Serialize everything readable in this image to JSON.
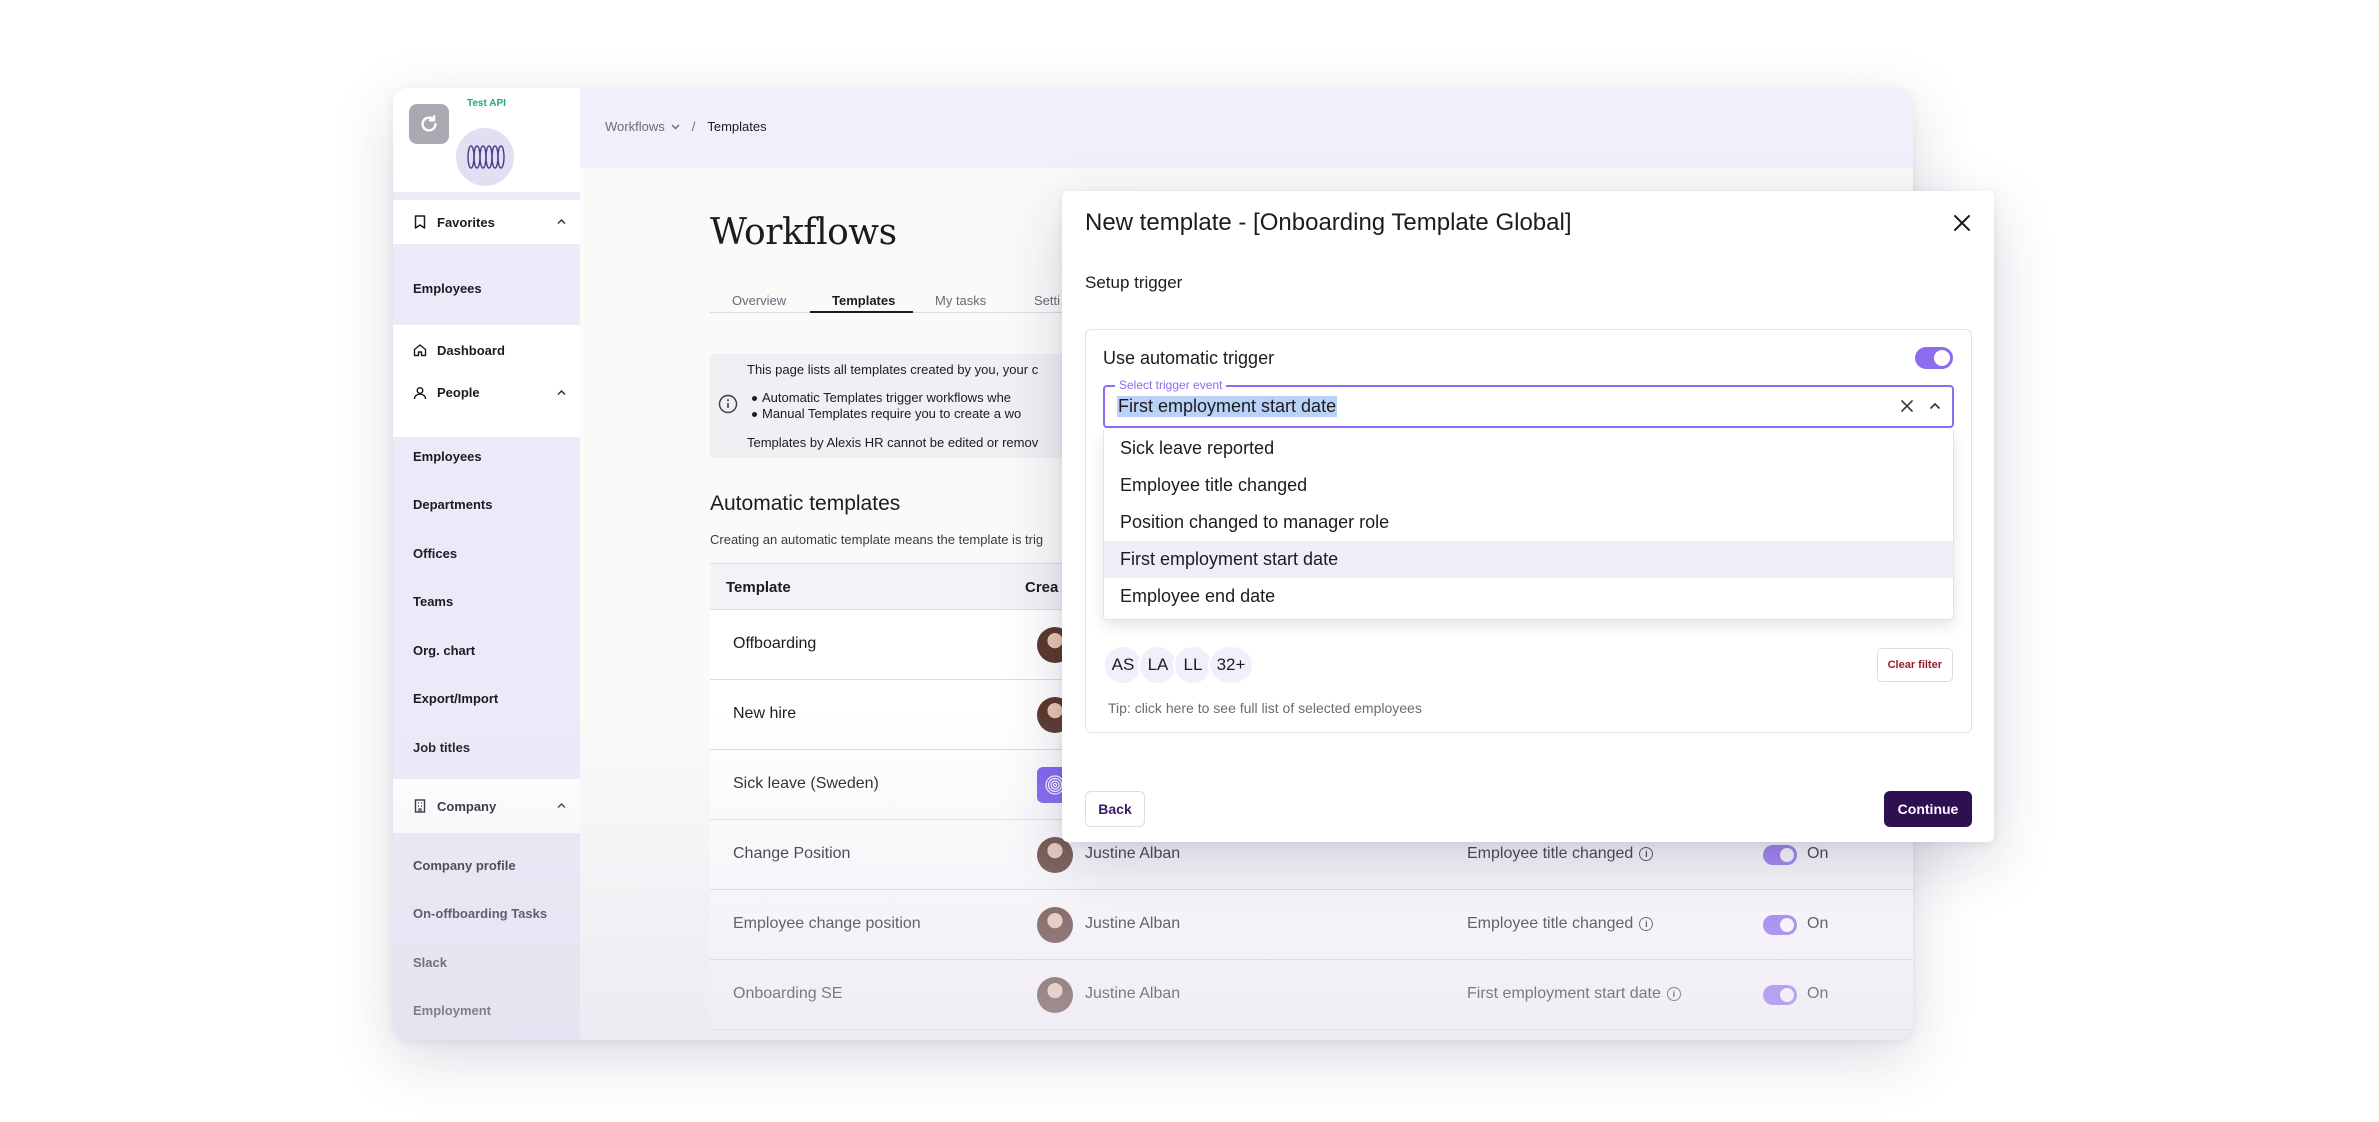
{
  "sidebar": {
    "test_api_label": "Test API",
    "groups": {
      "favorites": "Favorites",
      "dashboard": "Dashboard",
      "people": "People",
      "company": "Company"
    },
    "favorites_items": [
      "Employees"
    ],
    "people_items": [
      "Employees",
      "Departments",
      "Offices",
      "Teams",
      "Org. chart",
      "Export/Import",
      "Job titles"
    ],
    "company_items": [
      "Company profile",
      "On-offboarding Tasks",
      "Slack",
      "Employment"
    ]
  },
  "breadcrumb": {
    "parent": "Workflows",
    "separator": "/",
    "current": "Templates"
  },
  "page": {
    "title": "Workflows",
    "tabs": [
      "Overview",
      "Templates",
      "My tasks",
      "Setti"
    ]
  },
  "info": {
    "line1": "This page lists all templates created by you, your c",
    "bullet1": "Automatic Templates trigger workflows whe",
    "bullet2": "Manual Templates require you to create a wo",
    "line2": "Templates by Alexis HR cannot be edited or remov"
  },
  "automatic": {
    "title": "Automatic templates",
    "description": "Creating an automatic template means the template is trig"
  },
  "table": {
    "headers": {
      "template": "Template",
      "creator": "Crea"
    },
    "rows": [
      {
        "name": "Offboarding",
        "creator": "",
        "trigger": "",
        "status": ""
      },
      {
        "name": "New hire",
        "creator": "",
        "trigger": "",
        "status": ""
      },
      {
        "name": "Sick leave (Sweden)",
        "creator": "",
        "trigger": "",
        "status": ""
      },
      {
        "name": "Change Position",
        "creator": "Justine Alban",
        "trigger": "Employee title changed",
        "status": "On"
      },
      {
        "name": "Employee change position",
        "creator": "Justine Alban",
        "trigger": "Employee title changed",
        "status": "On"
      },
      {
        "name": "Onboarding SE",
        "creator": "Justine Alban",
        "trigger": "First employment start date",
        "status": "On"
      }
    ]
  },
  "modal": {
    "title": "New template - [Onboarding Template Global]",
    "subtitle": "Setup trigger",
    "auto_trigger_label": "Use automatic trigger",
    "select_label": "Select trigger event",
    "select_value": "First employment start date",
    "options": [
      "Sick leave reported",
      "Employee title changed",
      "Position changed to manager role",
      "First employment start date",
      "Employee end date"
    ],
    "selected_option_index": 3,
    "chips": [
      "AS",
      "LA",
      "LL",
      "32+"
    ],
    "clear_filter": "Clear filter",
    "tip": "Tip: click here to see full list of selected employees",
    "back": "Back",
    "continue": "Continue"
  },
  "colors": {
    "accent": "#8e6cf2",
    "primary_button": "#2d0f52",
    "danger_text": "#9a1c2a",
    "sidebar_bg": "#eceaf8",
    "success_text": "#22a86a"
  }
}
